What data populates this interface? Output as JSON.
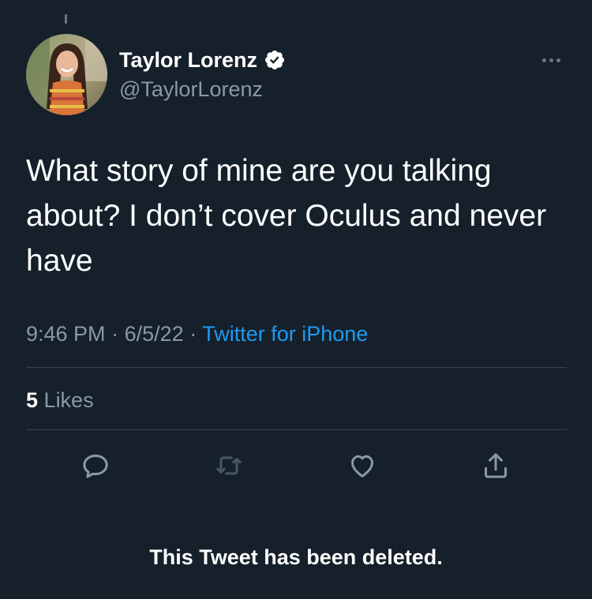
{
  "user": {
    "display_name": "Taylor Lorenz",
    "handle": "@TaylorLorenz",
    "verified_icon": "verified-badge-icon",
    "avatar_icon": "profile-photo"
  },
  "tweet": {
    "text": "What story of mine are you talking about? I don’t cover Oculus and never have",
    "time": "9:46 PM",
    "separator": "·",
    "date": "6/5/22",
    "source": "Twitter for iPhone"
  },
  "stats": {
    "likes_count": "5",
    "likes_label": "Likes"
  },
  "actions": {
    "reply_icon": "reply-icon",
    "retweet_icon": "retweet-icon",
    "like_icon": "heart-icon",
    "share_icon": "share-icon",
    "more_icon": "more-horizontal-icon"
  },
  "notice": {
    "deleted_text": "This Tweet has been deleted."
  },
  "colors": {
    "background": "#15202b",
    "secondary_text": "#8b98a5",
    "link": "#1d9bf0",
    "divider": "#38444d",
    "icon": "#8b98a5",
    "retweet_icon_dim": "#4a5866"
  }
}
